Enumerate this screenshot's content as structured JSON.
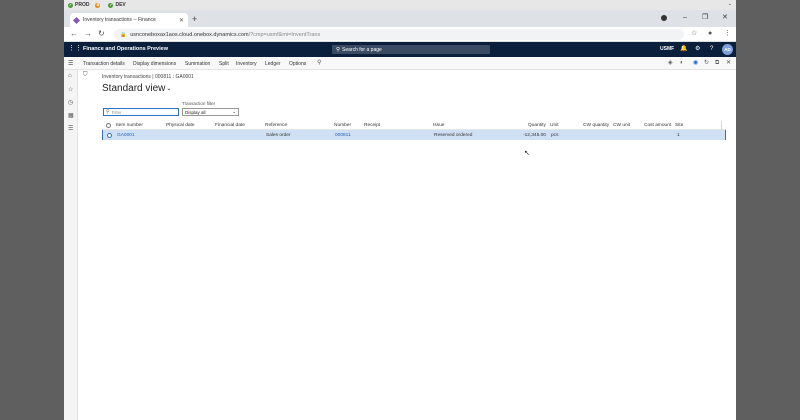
{
  "bookmarks": [
    {
      "label": "PROD",
      "icon": "check-circle-icon",
      "color": "#4a9a3a"
    },
    {
      "label": "",
      "icon": "settings-gear-icon",
      "color": "#e08a1a"
    },
    {
      "label": "DEV",
      "icon": "check-circle-icon",
      "color": "#4a9a3a"
    }
  ],
  "browser": {
    "tab_title": "Inventory transactions -- Finance",
    "url_host": "usnconeboxax1aos.cloud.onebox.dynamics.com",
    "url_path": "/?cmp=usmf&mi=InventTrans"
  },
  "app": {
    "name": "Finance and Operations Preview",
    "search_placeholder": "Search for a page",
    "company": "USMF",
    "avatar_initials": "AD",
    "nav_color": "#0a1f3c",
    "accent": "#2f72c4"
  },
  "actions": [
    "Transaction details",
    "Display dimensions",
    "Summation",
    "Split",
    "Inventory",
    "Ledger",
    "Options"
  ],
  "content": {
    "breadcrumb": "Inventory transactions  |  000811 : GA0001",
    "view_title": "Standard view",
    "filter_placeholder": "Filter",
    "transaction_filter_label": "Transaction filter",
    "transaction_filter_value": "Display all"
  },
  "grid": {
    "columns": [
      "Item number",
      "Physical date",
      "Financial date",
      "Reference",
      "Number",
      "Receipt",
      "Issue",
      "Quantity",
      "Unit",
      "CW quantity",
      "CW unit",
      "Cost amount",
      "Site"
    ],
    "rows": [
      {
        "item_number": "GA0001",
        "physical_date": "",
        "financial_date": "",
        "reference": "Sales order",
        "number": "000811",
        "receipt": "",
        "issue": "Reserved ordered",
        "quantity": "-12,345.00",
        "unit": "pcs",
        "cw_quantity": "",
        "cw_unit": "",
        "cost_amount": "",
        "site": "1"
      }
    ]
  }
}
